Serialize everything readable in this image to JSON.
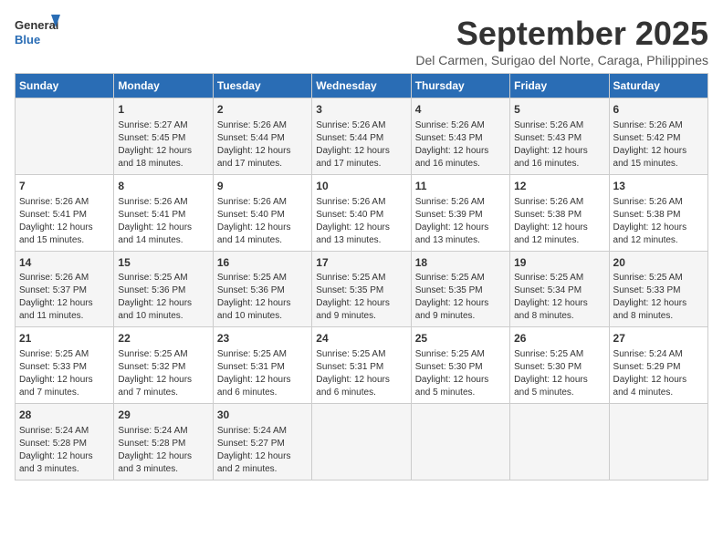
{
  "header": {
    "logo_line1": "General",
    "logo_line2": "Blue",
    "month": "September 2025",
    "location": "Del Carmen, Surigao del Norte, Caraga, Philippines"
  },
  "days_of_week": [
    "Sunday",
    "Monday",
    "Tuesday",
    "Wednesday",
    "Thursday",
    "Friday",
    "Saturday"
  ],
  "weeks": [
    [
      {
        "day": "",
        "content": ""
      },
      {
        "day": "1",
        "content": "Sunrise: 5:27 AM\nSunset: 5:45 PM\nDaylight: 12 hours\nand 18 minutes."
      },
      {
        "day": "2",
        "content": "Sunrise: 5:26 AM\nSunset: 5:44 PM\nDaylight: 12 hours\nand 17 minutes."
      },
      {
        "day": "3",
        "content": "Sunrise: 5:26 AM\nSunset: 5:44 PM\nDaylight: 12 hours\nand 17 minutes."
      },
      {
        "day": "4",
        "content": "Sunrise: 5:26 AM\nSunset: 5:43 PM\nDaylight: 12 hours\nand 16 minutes."
      },
      {
        "day": "5",
        "content": "Sunrise: 5:26 AM\nSunset: 5:43 PM\nDaylight: 12 hours\nand 16 minutes."
      },
      {
        "day": "6",
        "content": "Sunrise: 5:26 AM\nSunset: 5:42 PM\nDaylight: 12 hours\nand 15 minutes."
      }
    ],
    [
      {
        "day": "7",
        "content": "Sunrise: 5:26 AM\nSunset: 5:41 PM\nDaylight: 12 hours\nand 15 minutes."
      },
      {
        "day": "8",
        "content": "Sunrise: 5:26 AM\nSunset: 5:41 PM\nDaylight: 12 hours\nand 14 minutes."
      },
      {
        "day": "9",
        "content": "Sunrise: 5:26 AM\nSunset: 5:40 PM\nDaylight: 12 hours\nand 14 minutes."
      },
      {
        "day": "10",
        "content": "Sunrise: 5:26 AM\nSunset: 5:40 PM\nDaylight: 12 hours\nand 13 minutes."
      },
      {
        "day": "11",
        "content": "Sunrise: 5:26 AM\nSunset: 5:39 PM\nDaylight: 12 hours\nand 13 minutes."
      },
      {
        "day": "12",
        "content": "Sunrise: 5:26 AM\nSunset: 5:38 PM\nDaylight: 12 hours\nand 12 minutes."
      },
      {
        "day": "13",
        "content": "Sunrise: 5:26 AM\nSunset: 5:38 PM\nDaylight: 12 hours\nand 12 minutes."
      }
    ],
    [
      {
        "day": "14",
        "content": "Sunrise: 5:26 AM\nSunset: 5:37 PM\nDaylight: 12 hours\nand 11 minutes."
      },
      {
        "day": "15",
        "content": "Sunrise: 5:25 AM\nSunset: 5:36 PM\nDaylight: 12 hours\nand 10 minutes."
      },
      {
        "day": "16",
        "content": "Sunrise: 5:25 AM\nSunset: 5:36 PM\nDaylight: 12 hours\nand 10 minutes."
      },
      {
        "day": "17",
        "content": "Sunrise: 5:25 AM\nSunset: 5:35 PM\nDaylight: 12 hours\nand 9 minutes."
      },
      {
        "day": "18",
        "content": "Sunrise: 5:25 AM\nSunset: 5:35 PM\nDaylight: 12 hours\nand 9 minutes."
      },
      {
        "day": "19",
        "content": "Sunrise: 5:25 AM\nSunset: 5:34 PM\nDaylight: 12 hours\nand 8 minutes."
      },
      {
        "day": "20",
        "content": "Sunrise: 5:25 AM\nSunset: 5:33 PM\nDaylight: 12 hours\nand 8 minutes."
      }
    ],
    [
      {
        "day": "21",
        "content": "Sunrise: 5:25 AM\nSunset: 5:33 PM\nDaylight: 12 hours\nand 7 minutes."
      },
      {
        "day": "22",
        "content": "Sunrise: 5:25 AM\nSunset: 5:32 PM\nDaylight: 12 hours\nand 7 minutes."
      },
      {
        "day": "23",
        "content": "Sunrise: 5:25 AM\nSunset: 5:31 PM\nDaylight: 12 hours\nand 6 minutes."
      },
      {
        "day": "24",
        "content": "Sunrise: 5:25 AM\nSunset: 5:31 PM\nDaylight: 12 hours\nand 6 minutes."
      },
      {
        "day": "25",
        "content": "Sunrise: 5:25 AM\nSunset: 5:30 PM\nDaylight: 12 hours\nand 5 minutes."
      },
      {
        "day": "26",
        "content": "Sunrise: 5:25 AM\nSunset: 5:30 PM\nDaylight: 12 hours\nand 5 minutes."
      },
      {
        "day": "27",
        "content": "Sunrise: 5:24 AM\nSunset: 5:29 PM\nDaylight: 12 hours\nand 4 minutes."
      }
    ],
    [
      {
        "day": "28",
        "content": "Sunrise: 5:24 AM\nSunset: 5:28 PM\nDaylight: 12 hours\nand 3 minutes."
      },
      {
        "day": "29",
        "content": "Sunrise: 5:24 AM\nSunset: 5:28 PM\nDaylight: 12 hours\nand 3 minutes."
      },
      {
        "day": "30",
        "content": "Sunrise: 5:24 AM\nSunset: 5:27 PM\nDaylight: 12 hours\nand 2 minutes."
      },
      {
        "day": "",
        "content": ""
      },
      {
        "day": "",
        "content": ""
      },
      {
        "day": "",
        "content": ""
      },
      {
        "day": "",
        "content": ""
      }
    ]
  ]
}
